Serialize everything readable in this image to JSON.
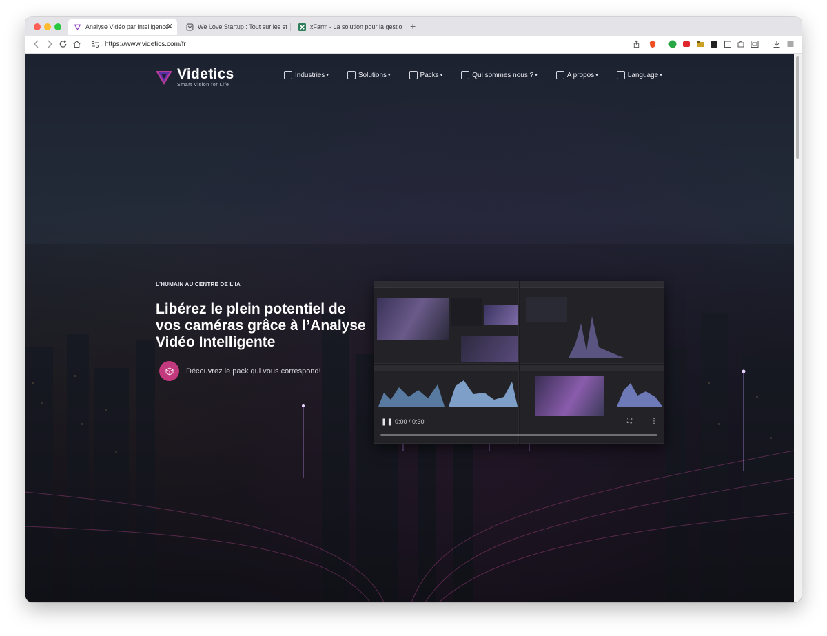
{
  "browser": {
    "tabs": [
      {
        "title": "Analyse Vidéo par Intelligence",
        "favicon": "videtics-logo-icon",
        "active": true
      },
      {
        "title": "We Love Startup : Tout sur les star",
        "favicon": "wls-favicon-icon",
        "active": false
      },
      {
        "title": "xFarm - La solution pour la gestion",
        "favicon": "xfarm-favicon-icon",
        "active": false
      }
    ],
    "close_glyph": "✕",
    "new_tab_glyph": "+",
    "url": "https://www.videtics.com/fr"
  },
  "site": {
    "logo": {
      "name": "Videtics",
      "tagline": "Smart Vision for Life"
    },
    "nav": [
      {
        "label": "Industries",
        "caret": "▾"
      },
      {
        "label": "Solutions",
        "caret": "▾"
      },
      {
        "label": "Packs",
        "caret": "▾"
      },
      {
        "label": "Qui sommes nous ?",
        "caret": "▾"
      },
      {
        "label": "A propos",
        "caret": "▾"
      },
      {
        "label": "Language",
        "caret": "▾"
      }
    ],
    "hero": {
      "eyebrow": "L'HUMAIN AU CENTRE DE L'IA",
      "headline": "Libérez le plein potentiel de vos caméras grâce à l’Analyse Vidéo Intelligente",
      "cta_text": "Découvrez le pack qui vous correspond!"
    },
    "video": {
      "time": "0:00 / 0:30",
      "progress": 0.0,
      "play_glyph": "❚❚",
      "fullscreen_glyph": "⛶",
      "more_glyph": "⋮"
    }
  },
  "colors": {
    "accent": "#c2397e",
    "page_bg": "#1d2230"
  }
}
